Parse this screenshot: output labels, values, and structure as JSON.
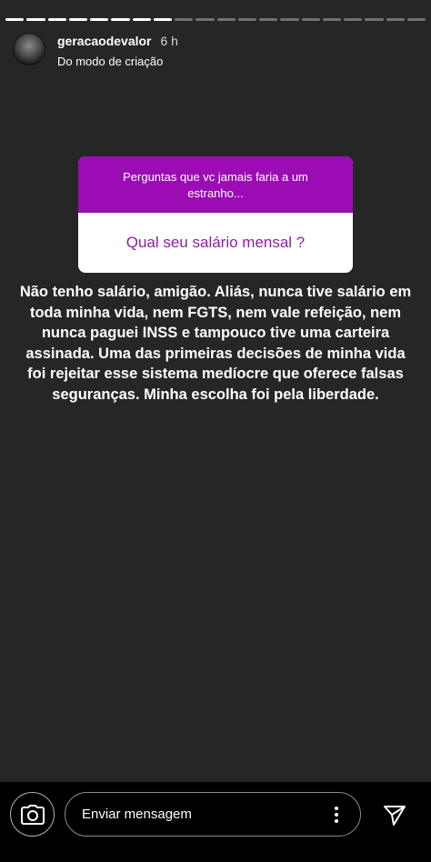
{
  "story": {
    "progress_segments_total": 20,
    "progress_segments_viewed": 8,
    "username": "geracaodevalor",
    "time": "6 h",
    "subtitle": "Do modo de criação"
  },
  "question_sticker": {
    "prompt": "Perguntas que vc jamais faria a um estranho...",
    "question": "Qual seu salário mensal ?",
    "accent_color": "#9b0cb4"
  },
  "answer_text": "Não tenho salário, amigão. Aliás, nunca tive salário em toda minha vida, nem FGTS, nem vale refeição, nem nunca paguei INSS e tampouco tive uma carteira assinada. Uma das primeiras decisões de minha vida foi rejeitar esse sistema medíocre que oferece falsas seguranças. Minha escolha foi pela liberdade.",
  "reply_bar": {
    "placeholder": "Enviar mensagem",
    "icons": [
      "camera-icon",
      "more-options-icon",
      "send-icon"
    ]
  }
}
